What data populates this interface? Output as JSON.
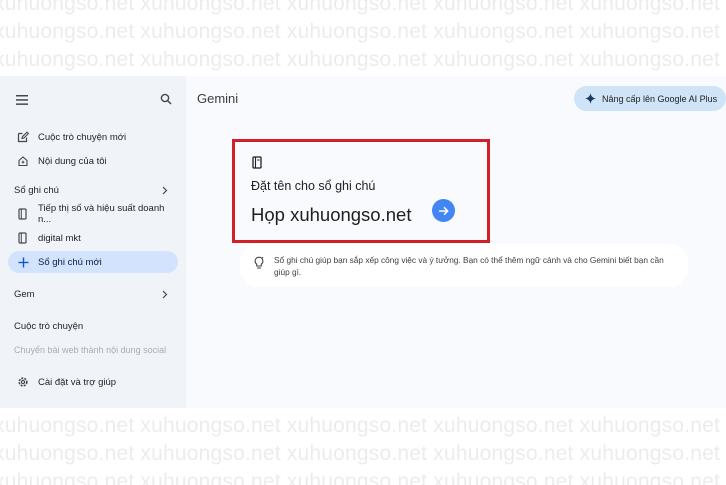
{
  "watermark": {
    "text_top": "xuhuongso.net xuhuongso.net xuhuongso.net xuhuongso.net xuhuongso.net xuhuongso.net",
    "text_bottom": "xuhuongso.net xuhuongso.net xuhuongso.net xuhuongso.net xuhuongso.net xuhuongso.net"
  },
  "sidebar": {
    "menu_icon": "menu-icon",
    "search_icon": "search-icon",
    "new_chat": "Cuộc trò chuyện mới",
    "my_content": "Nội dung của tôi",
    "notebooks_heading": "Sổ ghi chú",
    "notebooks": [
      {
        "label": "Tiếp thị số và hiệu suất doanh n..."
      },
      {
        "label": "digital mkt"
      }
    ],
    "new_notebook": "Sổ ghi chú mới",
    "gem_heading": "Gem",
    "chats_heading": "Cuộc trò chuyện",
    "recent_chat": "Chuyển bài web thành nội dung social",
    "settings": "Cài đặt và trợ giúp"
  },
  "main": {
    "title": "Gemini",
    "upgrade_label": "Nâng cấp lên Google AI Plus",
    "notebook_card": {
      "prompt": "Đặt tên cho sổ ghi chú",
      "name_value": "Họp xuhuongso.net"
    },
    "hint": "Sổ ghi chú giúp bạn sắp xếp công việc và ý tưởng. Bạn có thể thêm ngữ cảnh và cho Gemini biết bạn cần giúp gì."
  },
  "colors": {
    "sidebar_bg": "#f0f4f9",
    "active_item_bg": "#d3e3fd",
    "upgrade_bg": "#cfe4f7",
    "highlight_border": "#d31f26",
    "accent_blue": "#4285f4"
  }
}
